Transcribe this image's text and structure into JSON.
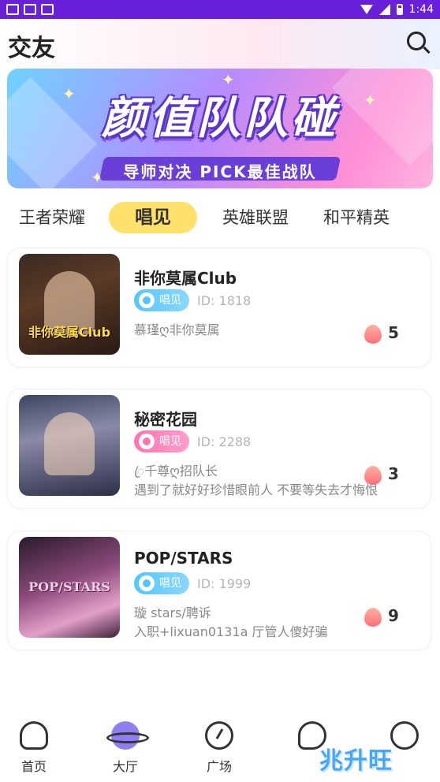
{
  "status_bar": {
    "time": "1:44"
  },
  "header": {
    "title": "交友"
  },
  "banner": {
    "title": "颜值队队碰",
    "subtitle": "导师对决 PICK最佳战队"
  },
  "tabs": [
    {
      "label": "王者荣耀",
      "active": false
    },
    {
      "label": "唱见",
      "active": true
    },
    {
      "label": "英雄联盟",
      "active": false
    },
    {
      "label": "和平精英",
      "active": false
    }
  ],
  "rooms": [
    {
      "name": "非你莫属Club",
      "tag": "唱见",
      "tag_color": "#53c6ff",
      "id": "ID: 1818",
      "line1": "慕瑾ღ非你莫属",
      "line2": "",
      "thumb_text": "非你莫属Club",
      "heat": "5"
    },
    {
      "name": "秘密花园",
      "tag": "唱见",
      "tag_color": "#ff73b0",
      "id": "ID: 2288",
      "line1": "ꦿ千尊ღ招队长",
      "line2": "遇到了就好好珍惜眼前人 不要等失去才悔恨",
      "thumb_text": "",
      "heat": "3"
    },
    {
      "name": "POP/STARS",
      "tag": "唱见",
      "tag_color": "#53c6ff",
      "id": "ID: 1999",
      "line1": "璇 stars/聘诉",
      "line2": "入职+lixuan0131a 厅管人傻好骗",
      "thumb_text": "POP/STARS",
      "heat": "9"
    }
  ],
  "bottom_nav": [
    {
      "label": "首页",
      "icon": "home-icon"
    },
    {
      "label": "大厅",
      "icon": "planet-icon"
    },
    {
      "label": "广场",
      "icon": "compass-icon"
    },
    {
      "label": "",
      "icon": "chat-icon"
    },
    {
      "label": "",
      "icon": "face-icon"
    }
  ],
  "watermark": "兆升旺"
}
